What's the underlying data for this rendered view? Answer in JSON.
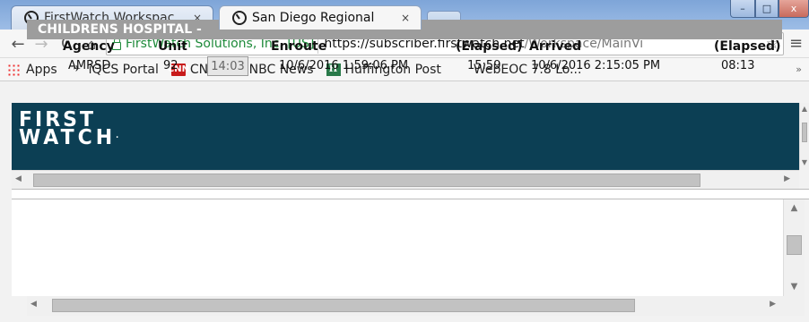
{
  "tabs": [
    {
      "title": "FirstWatch Workspac",
      "close": "×",
      "active": false
    },
    {
      "title": "San Diego Regional",
      "close": "×",
      "active": true
    }
  ],
  "window_controls": {
    "minimize": "–",
    "maximize": "□",
    "close": "x"
  },
  "toolbar": {
    "back": "←",
    "forward": "→",
    "reload": "C",
    "home": "⌂",
    "menu": "≡",
    "star": "☆"
  },
  "address_bar": {
    "ev_name": "FirstWatch Solutions, Inc. [US]",
    "url_scheme_host": "https://subscriber.firstwatch.net",
    "url_path": "/Workspace/MainVi"
  },
  "bookmarks": [
    {
      "label": "Apps",
      "icon": "apps-grid-icon"
    },
    {
      "label": "iQCS Portal",
      "icon": "iqcs-icon"
    },
    {
      "label": "CNN",
      "icon": "cnn-icon",
      "icon_text": "CNN"
    },
    {
      "label": "NBC News",
      "icon": "nbc-peacock-icon",
      "icon_text": "✻"
    },
    {
      "label": "Huffington Post",
      "icon": "huffpost-icon",
      "icon_text": "H"
    },
    {
      "label": "WebEOC 7.8 Lo...",
      "icon": "none"
    }
  ],
  "bookmarks_overflow": "»",
  "logo": {
    "line1": "FIRST",
    "line2": "WATCH",
    "tm": "·"
  },
  "hospital": {
    "name": "CHILDRENS HOSPITAL -",
    "columns": {
      "agency": "Agency",
      "unit": "Unit",
      "enroute": "Enroute",
      "elapsed1": "(Elapsed)",
      "arrived": "Arrived",
      "elapsed2": "(Elapsed)"
    },
    "row": {
      "agency": "AMRSD",
      "unit": "92",
      "timer": "14:03",
      "enroute": "10/6/2016 1:59:06 PM",
      "elapsed1": "15:59",
      "arrived": "10/6/2016 2:15:05 PM",
      "elapsed2": "08:13"
    }
  },
  "scroll": {
    "up": "▲",
    "down": "▼",
    "left": "◀",
    "right": "▶"
  },
  "colors": {
    "banner": "#0c3f54",
    "hospital_header": "#9d9d9d",
    "ev_green": "#1e8a3a",
    "tabstrip": "#7ea5d8"
  }
}
